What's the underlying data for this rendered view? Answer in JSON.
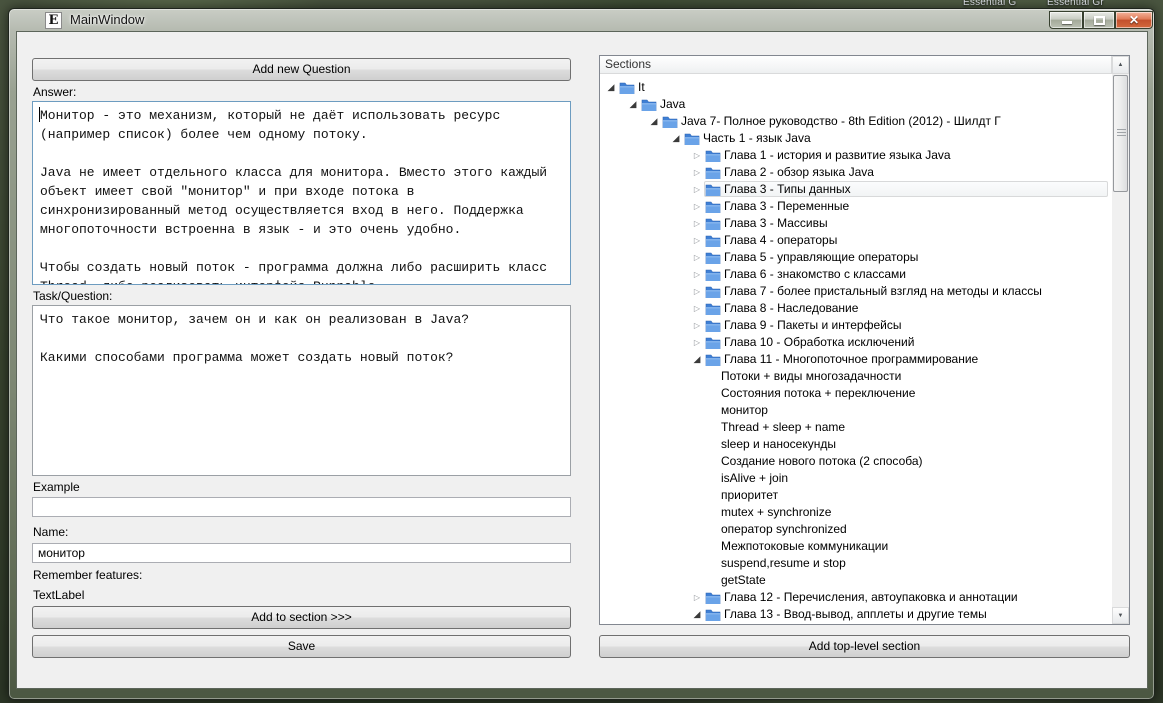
{
  "desktop": {
    "background_labels": [
      "Essential G",
      "Essential Gr"
    ]
  },
  "window": {
    "title": "MainWindow",
    "app_icon": "E",
    "controls": {
      "minimize_icon": "minimize-bar",
      "maximize_icon": "maximize-square",
      "close_icon": "✕"
    }
  },
  "left_panel": {
    "add_question_button": "Add new Question",
    "answer_label": "Answer:",
    "answer_text": "Монитор - это механизм, который не даёт использовать ресурс\n(например список) более чем одному потоку.\n\nJava не имеет отдельного класса для монитора. Вместо этого каждый\nобъект имеет свой \"монитор\" и при входе потока в\nсинхронизированный метод осуществляется вход в него. Поддержка\nмногопоточности встроенна в язык - и это очень удобно.\n\nЧтобы создать новый поток - программа должна либо расширить класс\nThread, либо реализовать интерфейс Runnable.",
    "task_label": "Task/Question:",
    "task_text": "Что такое монитор, зачем он и как он реализован в Java?\n\nКакими способами программа может создать новый поток?",
    "example_label": "Example",
    "example_value": "",
    "name_label": "Name:",
    "name_value": "монитор",
    "remember_label": "Remember features:",
    "remember_value": "TextLabel",
    "add_to_section_button": "Add to section >>>",
    "save_button": "Save"
  },
  "sections_panel": {
    "header": "Sections",
    "add_top_level_button": "Add top-level section",
    "scrollbar": {
      "up_icon": "▲",
      "down_icon": "▼"
    },
    "folder_color": "#4a8ade",
    "tree": [
      {
        "label": "It",
        "level": 0,
        "arrow": "expanded",
        "icon": "folder"
      },
      {
        "label": "Java",
        "level": 1,
        "arrow": "expanded",
        "icon": "folder"
      },
      {
        "label": "Java 7- Полное руководство - 8th Edition (2012) - Шилдт Г",
        "level": 2,
        "arrow": "expanded",
        "icon": "folder"
      },
      {
        "label": "Часть 1 - язык Java",
        "level": 3,
        "arrow": "expanded",
        "icon": "folder"
      },
      {
        "label": "Глава 1 - история и развитие языка Java",
        "level": 4,
        "arrow": "collapsed",
        "icon": "folder"
      },
      {
        "label": "Глава 2 - обзор языка Java",
        "level": 4,
        "arrow": "collapsed",
        "icon": "folder"
      },
      {
        "label": "Глава 3 - Типы данных",
        "level": 4,
        "arrow": "collapsed",
        "icon": "folder",
        "highlighted": true
      },
      {
        "label": "Глава 3 - Переменные",
        "level": 4,
        "arrow": "collapsed",
        "icon": "folder"
      },
      {
        "label": "Глава 3 - Массивы",
        "level": 4,
        "arrow": "collapsed",
        "icon": "folder"
      },
      {
        "label": "Глава 4 - операторы",
        "level": 4,
        "arrow": "collapsed",
        "icon": "folder"
      },
      {
        "label": "Глава 5 - управляющие операторы",
        "level": 4,
        "arrow": "collapsed",
        "icon": "folder"
      },
      {
        "label": "Глава 6 - знакомство с классами",
        "level": 4,
        "arrow": "collapsed",
        "icon": "folder"
      },
      {
        "label": "Глава 7 - более пристальный взгляд на методы и классы",
        "level": 4,
        "arrow": "collapsed",
        "icon": "folder"
      },
      {
        "label": "Глава 8 - Наследование",
        "level": 4,
        "arrow": "collapsed",
        "icon": "folder"
      },
      {
        "label": "Глава 9 - Пакеты и интерфейсы",
        "level": 4,
        "arrow": "collapsed",
        "icon": "folder"
      },
      {
        "label": "Глава 10 - Обработка исключений",
        "level": 4,
        "arrow": "collapsed",
        "icon": "folder"
      },
      {
        "label": "Глава 11 - Многопоточное программирование",
        "level": 4,
        "arrow": "expanded",
        "icon": "folder"
      },
      {
        "label": "Потоки + виды многозадачности",
        "level": 5,
        "arrow": null,
        "icon": null
      },
      {
        "label": "Состояния потока + переключение",
        "level": 5,
        "arrow": null,
        "icon": null
      },
      {
        "label": "монитор",
        "level": 5,
        "arrow": null,
        "icon": null
      },
      {
        "label": "Thread + sleep + name",
        "level": 5,
        "arrow": null,
        "icon": null
      },
      {
        "label": "sleep и наносекунды",
        "level": 5,
        "arrow": null,
        "icon": null
      },
      {
        "label": "Создание нового потока (2 способа)",
        "level": 5,
        "arrow": null,
        "icon": null
      },
      {
        "label": "isAlive + join",
        "level": 5,
        "arrow": null,
        "icon": null
      },
      {
        "label": "приоритет",
        "level": 5,
        "arrow": null,
        "icon": null
      },
      {
        "label": "mutex + synchronize",
        "level": 5,
        "arrow": null,
        "icon": null
      },
      {
        "label": "оператор synchronized",
        "level": 5,
        "arrow": null,
        "icon": null
      },
      {
        "label": "Межпотоковые коммуникации",
        "level": 5,
        "arrow": null,
        "icon": null
      },
      {
        "label": "suspend,resume и stop",
        "level": 5,
        "arrow": null,
        "icon": null
      },
      {
        "label": "getState",
        "level": 5,
        "arrow": null,
        "icon": null
      },
      {
        "label": "Глава 12 - Перечисления, автоупаковка и аннотации",
        "level": 4,
        "arrow": "collapsed",
        "icon": "folder"
      },
      {
        "label": "Глава 13 - Ввод-вывод, апплеты и другие темы",
        "level": 4,
        "arrow": "expanded",
        "icon": "folder"
      },
      {
        "label": "",
        "level": 4,
        "arrow": "collapsed",
        "icon": "folder",
        "partial": true
      }
    ]
  },
  "colors": {
    "client_background": "#f0f0f0",
    "answer_border": "#6d9cc0",
    "close_button_red": "#c3502c",
    "folder_blue": "#4a8ade",
    "highlight_border": "#d8d9da"
  }
}
